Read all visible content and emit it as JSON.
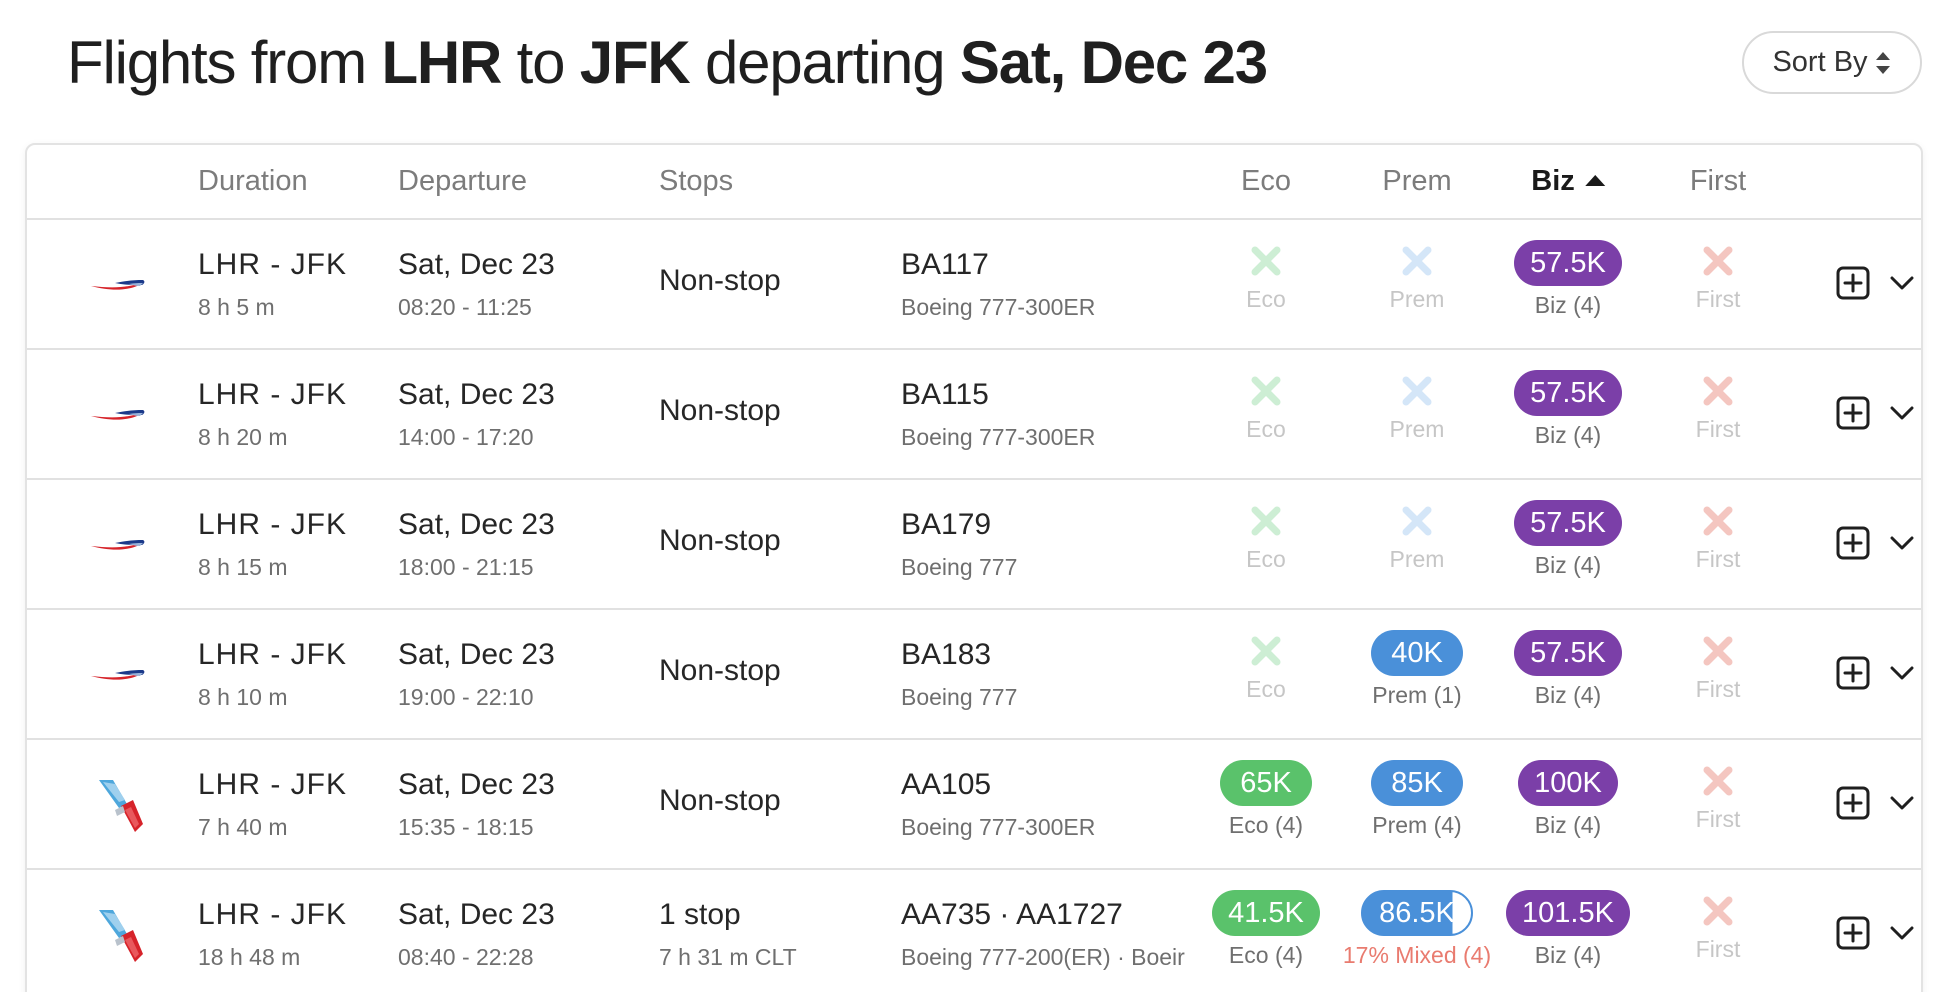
{
  "title": {
    "prefix": "Flights from ",
    "origin": "LHR",
    "to": " to ",
    "destination": "JFK",
    "departing": " departing ",
    "date": "Sat, Dec 23"
  },
  "sort_label": "Sort By",
  "columns": {
    "duration": "Duration",
    "departure": "Departure",
    "stops": "Stops",
    "eco": "Eco",
    "prem": "Prem",
    "biz": "Biz",
    "first": "First"
  },
  "colors": {
    "eco_green": "#5ac26b",
    "prem_blue": "#4a90d9",
    "biz_purple": "#7b3fa8",
    "first_x": "#f4c6c0",
    "eco_x": "#cdeed4",
    "prem_x": "#d4e6f8",
    "mixed_text": "#e97b6f"
  },
  "rows": [
    {
      "airline": "ba",
      "route": "LHR - JFK",
      "duration": "8 h 5 m",
      "date": "Sat, Dec 23",
      "times": "08:20 - 11:25",
      "stops": "Non-stop",
      "stops_detail": "",
      "flight": "BA117",
      "aircraft": "Boeing 777-300ER",
      "eco": {
        "price": "",
        "label": "Eco"
      },
      "prem": {
        "price": "",
        "label": "Prem"
      },
      "biz": {
        "price": "57.5K",
        "label": "Biz (4)"
      },
      "first": {
        "price": "",
        "label": "First"
      }
    },
    {
      "airline": "ba",
      "route": "LHR - JFK",
      "duration": "8 h 20 m",
      "date": "Sat, Dec 23",
      "times": "14:00 - 17:20",
      "stops": "Non-stop",
      "stops_detail": "",
      "flight": "BA115",
      "aircraft": "Boeing 777-300ER",
      "eco": {
        "price": "",
        "label": "Eco"
      },
      "prem": {
        "price": "",
        "label": "Prem"
      },
      "biz": {
        "price": "57.5K",
        "label": "Biz (4)"
      },
      "first": {
        "price": "",
        "label": "First"
      }
    },
    {
      "airline": "ba",
      "route": "LHR - JFK",
      "duration": "8 h 15 m",
      "date": "Sat, Dec 23",
      "times": "18:00 - 21:15",
      "stops": "Non-stop",
      "stops_detail": "",
      "flight": "BA179",
      "aircraft": "Boeing 777",
      "eco": {
        "price": "",
        "label": "Eco"
      },
      "prem": {
        "price": "",
        "label": "Prem"
      },
      "biz": {
        "price": "57.5K",
        "label": "Biz (4)"
      },
      "first": {
        "price": "",
        "label": "First"
      }
    },
    {
      "airline": "ba",
      "route": "LHR - JFK",
      "duration": "8 h 10 m",
      "date": "Sat, Dec 23",
      "times": "19:00 - 22:10",
      "stops": "Non-stop",
      "stops_detail": "",
      "flight": "BA183",
      "aircraft": "Boeing 777",
      "eco": {
        "price": "",
        "label": "Eco"
      },
      "prem": {
        "price": "40K",
        "label": "Prem (1)"
      },
      "biz": {
        "price": "57.5K",
        "label": "Biz (4)"
      },
      "first": {
        "price": "",
        "label": "First"
      }
    },
    {
      "airline": "aa",
      "route": "LHR - JFK",
      "duration": "7 h 40 m",
      "date": "Sat, Dec 23",
      "times": "15:35 - 18:15",
      "stops": "Non-stop",
      "stops_detail": "",
      "flight": "AA105",
      "aircraft": "Boeing 777-300ER",
      "eco": {
        "price": "65K",
        "label": "Eco (4)"
      },
      "prem": {
        "price": "85K",
        "label": "Prem (4)"
      },
      "biz": {
        "price": "100K",
        "label": "Biz (4)"
      },
      "first": {
        "price": "",
        "label": "First"
      }
    },
    {
      "airline": "aa",
      "route": "LHR - JFK",
      "duration": "18 h 48 m",
      "date": "Sat, Dec 23",
      "times": "08:40 - 22:28",
      "stops": "1 stop",
      "stops_detail": "7 h 31 m  CLT",
      "flight": "AA735  ·  AA1727",
      "aircraft": "Boeing 777-200(ER)  ·  Boeir",
      "eco": {
        "price": "41.5K",
        "label": "Eco (4)"
      },
      "prem": {
        "price": "86.5K",
        "label": "17% Mixed (4)",
        "mixed": true
      },
      "biz": {
        "price": "101.5K",
        "label": "Biz (4)"
      },
      "first": {
        "price": "",
        "label": "First"
      }
    }
  ]
}
